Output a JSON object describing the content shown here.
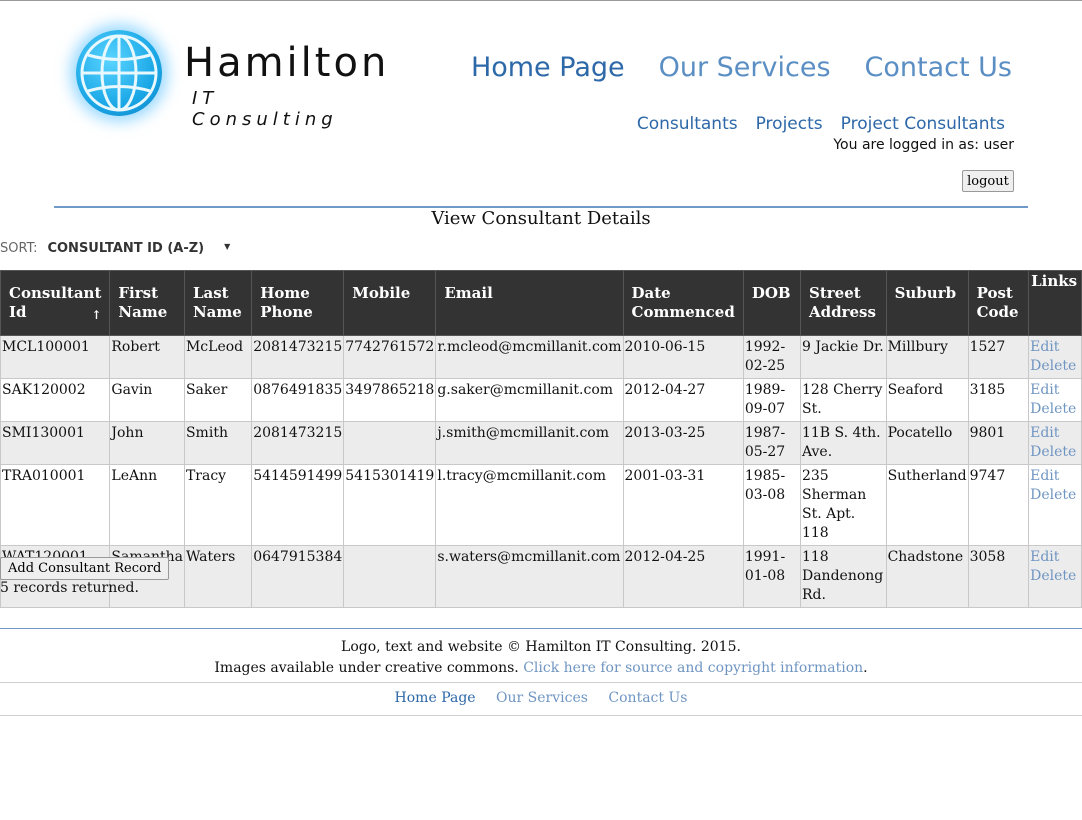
{
  "brand": {
    "title": "Hamilton",
    "subtitle": "IT Consulting"
  },
  "main_nav": {
    "home": "Home Page",
    "services": "Our Services",
    "contact": "Contact Us"
  },
  "sub_nav": {
    "consultants": "Consultants",
    "projects": "Projects",
    "project_consultants": "Project Consultants"
  },
  "session": {
    "logged_in_text": "You are logged in as: user",
    "logout_label": "logout"
  },
  "page": {
    "title": "View Consultant Details",
    "sort_label": "SORT:",
    "sort_value": "CONSULTANT ID (A-Z)",
    "sort_arrow": "↑"
  },
  "table": {
    "headers": [
      "Consultant Id",
      "First Name",
      "Last Name",
      "Home Phone",
      "Mobile",
      "Email",
      "Date Commenced",
      "DOB",
      "Street Address",
      "Suburb",
      "Post Code",
      "Links"
    ],
    "rows": [
      [
        "MCL100001",
        "Robert",
        "McLeod",
        "2081473215",
        "7742761572",
        "r.mcleod@mcmillanit.com",
        "2010-06-15",
        "1992-02-25",
        "9 Jackie Dr.",
        "Millbury",
        "1527"
      ],
      [
        "SAK120002",
        "Gavin",
        "Saker",
        "0876491835",
        "3497865218",
        "g.saker@mcmillanit.com",
        "2012-04-27",
        "1989-09-07",
        "128 Cherry St.",
        "Seaford",
        "3185"
      ],
      [
        "SMI130001",
        "John",
        "Smith",
        "2081473215",
        "",
        "j.smith@mcmillanit.com",
        "2013-03-25",
        "1987-05-27",
        "11B S. 4th. Ave.",
        "Pocatello",
        "9801"
      ],
      [
        "TRA010001",
        "LeAnn",
        "Tracy",
        "5414591499",
        "5415301419",
        "l.tracy@mcmillanit.com",
        "2001-03-31",
        "1985-03-08",
        "235 Sherman St. Apt. 118",
        "Sutherland",
        "9747"
      ],
      [
        "WAT120001",
        "Samantha",
        "Waters",
        "0647915384",
        "",
        "s.waters@mcmillanit.com",
        "2012-04-25",
        "1991-01-08",
        "118 Dandenong Rd.",
        "Chadstone",
        "3058"
      ]
    ],
    "edit_label": "Edit",
    "delete_label": "Delete"
  },
  "actions": {
    "add_label": "Add Consultant Record",
    "records_text": "5 records returned."
  },
  "footer": {
    "copyright": "Logo, text and website © Hamilton IT Consulting. 2015.",
    "images_text": "Images available under creative commons. ",
    "images_link": "Click here for source and copyright information",
    "images_end": ".",
    "nav": {
      "home": "Home Page",
      "services": "Our Services",
      "contact": "Contact Us"
    }
  },
  "colors": {
    "nav_dark": "#2d68a8",
    "nav_light": "#5b8fc4",
    "header_bg": "#333333",
    "row_alt": "#ececec"
  }
}
